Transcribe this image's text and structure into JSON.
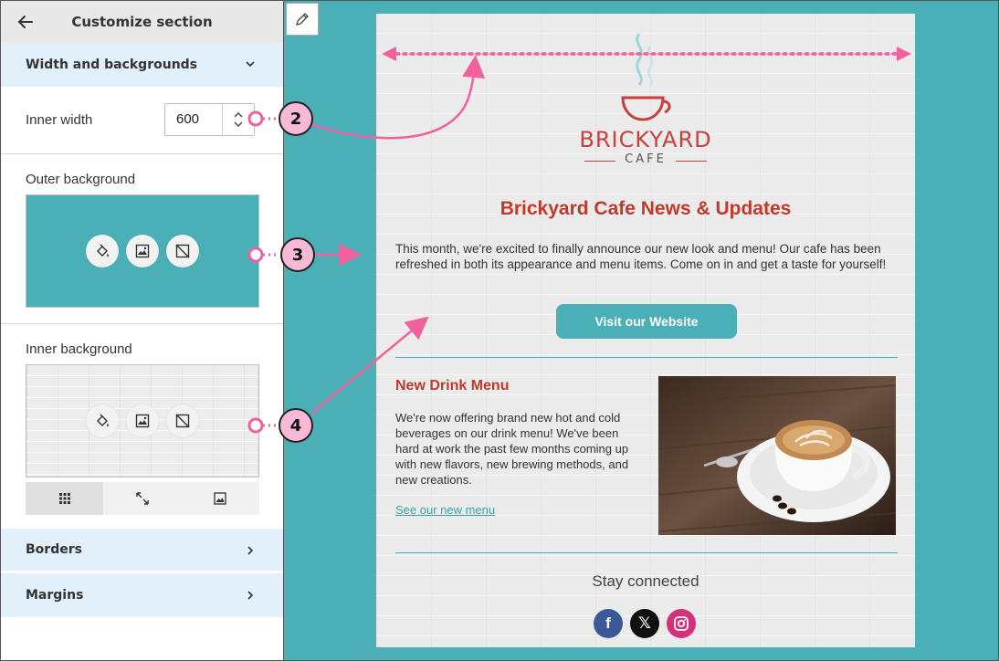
{
  "panel": {
    "title": "Customize section",
    "sections": {
      "width_backgrounds": "Width and backgrounds",
      "borders": "Borders",
      "margins": "Margins"
    },
    "inner_width": {
      "label": "Inner width",
      "value": "600"
    },
    "outer_background": {
      "label": "Outer background",
      "color": "#4aafb7"
    },
    "inner_background": {
      "label": "Inner background"
    },
    "icons": {
      "back": "arrow-left-icon",
      "fill": "paint-bucket-icon",
      "image": "image-icon",
      "remove": "no-image-icon",
      "tile": "grid-dots-icon",
      "stretch": "expand-arrows-icon",
      "fit": "image-fit-icon"
    }
  },
  "email": {
    "logo": {
      "brand": "BRICKYARD",
      "sub": "CAFE"
    },
    "headline": "Brickyard Cafe News & Updates",
    "intro": "This month, we're excited to finally announce our new look and menu! Our cafe has been refreshed in both its appearance and menu items. Come on in and get a taste for yourself!",
    "cta": "Visit our Website",
    "drink": {
      "title": "New Drink Menu",
      "text": "We're now offering brand new hot and cold beverages on our drink menu! We've been hard at work the past few months coming up with new flavors, new brewing methods, and new creations.",
      "link": "See our new menu"
    },
    "stay_connected": "Stay connected",
    "socials": [
      "facebook-icon",
      "x-icon",
      "instagram-icon"
    ]
  },
  "callouts": [
    "2",
    "3",
    "4"
  ],
  "colors": {
    "accent": "#4aafb7",
    "headline": "#c0392b",
    "callout": "#f2609e",
    "badge_fill": "#f7b9d6"
  }
}
